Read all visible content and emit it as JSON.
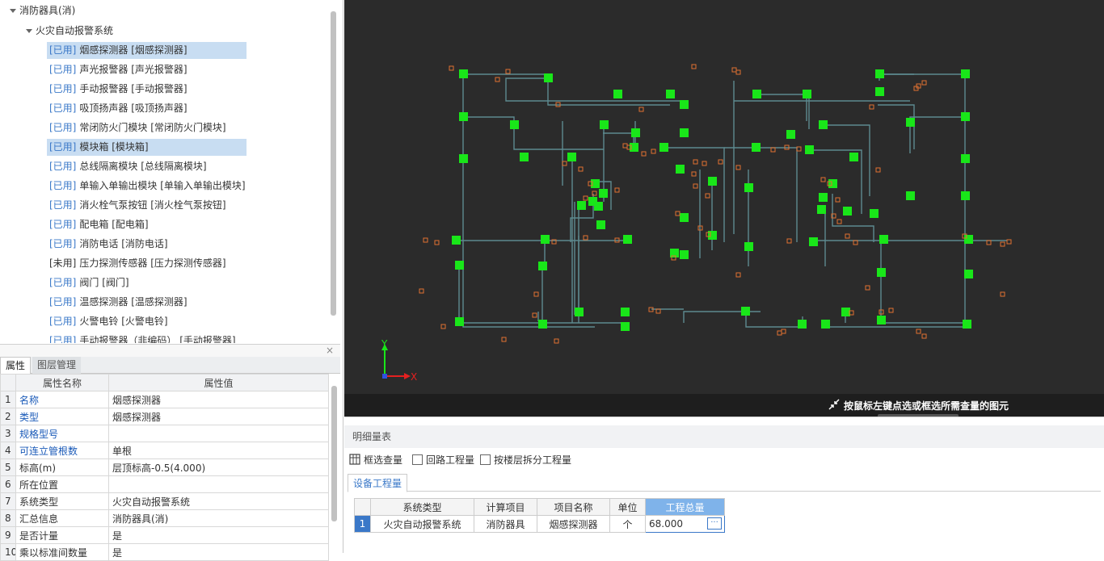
{
  "tree": {
    "root_label": "消防器具(消)",
    "system_label": "火灾自动报警系统",
    "items": [
      {
        "prefix": "[已用]",
        "label": "烟感探测器 [烟感探测器]",
        "selected": true
      },
      {
        "prefix": "[已用]",
        "label": "声光报警器 [声光报警器]",
        "selected": false
      },
      {
        "prefix": "[已用]",
        "label": "手动报警器 [手动报警器]",
        "selected": false
      },
      {
        "prefix": "[已用]",
        "label": "吸顶扬声器 [吸顶扬声器]",
        "selected": false
      },
      {
        "prefix": "[已用]",
        "label": "常闭防火门模块 [常闭防火门模块]",
        "selected": false
      },
      {
        "prefix": "[已用]",
        "label": "模块箱 [模块箱]",
        "selected": true
      },
      {
        "prefix": "[已用]",
        "label": "总线隔离模块 [总线隔离模块]",
        "selected": false
      },
      {
        "prefix": "[已用]",
        "label": "单输入单输出模块 [单输入单输出模块]",
        "selected": false
      },
      {
        "prefix": "[已用]",
        "label": "消火栓气泵按钮 [消火栓气泵按钮]",
        "selected": false
      },
      {
        "prefix": "[已用]",
        "label": "配电箱 [配电箱]",
        "selected": false
      },
      {
        "prefix": "[已用]",
        "label": "消防电话 [消防电话]",
        "selected": false
      },
      {
        "prefix": "[未用]",
        "label": "压力探测传感器 [压力探测传感器]",
        "selected": false
      },
      {
        "prefix": "[已用]",
        "label": "阀门 [阀门]",
        "selected": false
      },
      {
        "prefix": "[已用]",
        "label": "温感探测器 [温感探测器]",
        "selected": false
      },
      {
        "prefix": "[已用]",
        "label": "火警电铃 [火警电铃]",
        "selected": false
      },
      {
        "prefix": "[已用]",
        "label": "手动报警器（非编码） [手动报警器]",
        "selected": false
      }
    ]
  },
  "close_glyph": "×",
  "prop_tabs": {
    "active": "属性",
    "inactive": "图层管理"
  },
  "prop_table": {
    "headers": {
      "name": "属性名称",
      "value": "属性值"
    },
    "rows": [
      {
        "num": "1",
        "key": "名称",
        "value": "烟感探测器",
        "blue": true
      },
      {
        "num": "2",
        "key": "类型",
        "value": "烟感探测器",
        "blue": true
      },
      {
        "num": "3",
        "key": "规格型号",
        "value": "",
        "blue": true
      },
      {
        "num": "4",
        "key": "可连立管根数",
        "value": "单根",
        "blue": true
      },
      {
        "num": "5",
        "key": "标高(m)",
        "value": "层顶标高-0.5(4.000)",
        "blue": false
      },
      {
        "num": "6",
        "key": "所在位置",
        "value": "",
        "blue": false
      },
      {
        "num": "7",
        "key": "系统类型",
        "value": "火灾自动报警系统",
        "blue": false
      },
      {
        "num": "8",
        "key": "汇总信息",
        "value": "消防器具(消)",
        "blue": false
      },
      {
        "num": "9",
        "key": "是否计量",
        "value": "是",
        "blue": false
      },
      {
        "num": "10",
        "key": "乘以标准间数量",
        "value": "是",
        "blue": false
      }
    ]
  },
  "canvas": {
    "status_text": "按鼠标左键点选或框选所需查量的图元",
    "axis_x": "X",
    "axis_y": "Y",
    "colors": {
      "bg": "#2b2b2b",
      "device": "#19e619",
      "wire": "#5d8a90",
      "tag": "#e07030"
    }
  },
  "detail": {
    "title": "明细量表",
    "tool_select": "框选查量",
    "cb_loop": "回路工程量",
    "cb_floor": "按楼层拆分工程量",
    "tab": "设备工程量",
    "headers": [
      "系统类型",
      "计算项目",
      "项目名称",
      "单位",
      "工程总量"
    ],
    "rows": [
      {
        "num": "1",
        "cells": [
          "火灾自动报警系统",
          "消防器具",
          "烟感探测器",
          "个",
          "68.000"
        ]
      }
    ],
    "ellipsis": "···"
  }
}
